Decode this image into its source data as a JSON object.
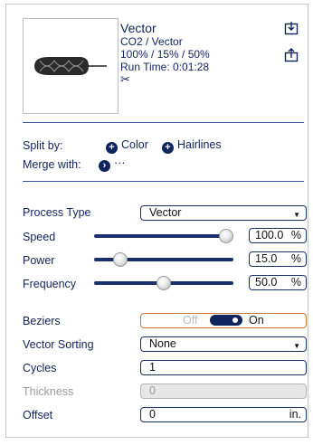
{
  "header": {
    "title": "Vector",
    "subtitle": "CO2 / Vector",
    "settings": "100% / 15% / 50%",
    "run_time": "Run Time: 0:01:28",
    "scissors_glyph": "✂",
    "icons": [
      "import-icon",
      "export-icon",
      "scissors-icon"
    ]
  },
  "split": {
    "label": "Split by:",
    "color_label": "Color",
    "hairlines_label": "Hairlines"
  },
  "merge": {
    "label": "Merge with:",
    "more_label": "···"
  },
  "process_type": {
    "label": "Process Type",
    "value": "Vector"
  },
  "speed": {
    "label": "Speed",
    "value": "100.0",
    "unit": "%",
    "level": 1.0
  },
  "power": {
    "label": "Power",
    "value": "15.0",
    "unit": "%",
    "level": 0.15
  },
  "frequency": {
    "label": "Frequency",
    "value": "50.0",
    "unit": "%",
    "level": 0.5
  },
  "beziers": {
    "label": "Beziers",
    "off_label": "Off",
    "on_label": "On",
    "state": "on"
  },
  "vector_sorting": {
    "label": "Vector Sorting",
    "value": "None"
  },
  "cycles": {
    "label": "Cycles",
    "value": "1"
  },
  "thickness": {
    "label": "Thickness",
    "value": "0"
  },
  "offset": {
    "label": "Offset",
    "value": "0",
    "unit": "in."
  },
  "colors": {
    "accent": "#10245e",
    "toggle_border": "#c87935"
  }
}
